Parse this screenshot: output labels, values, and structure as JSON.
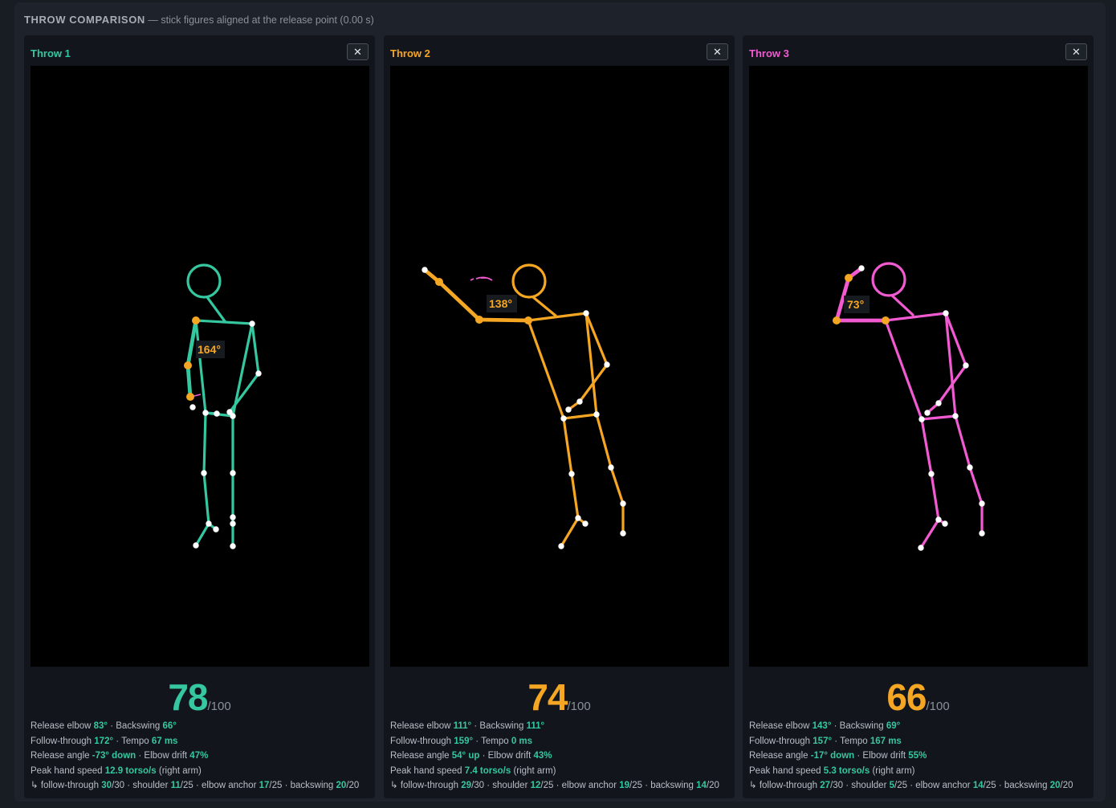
{
  "header": {
    "title": "THROW COMPARISON",
    "subtitle": "— stick figures aligned at the release point (0.00 s)"
  },
  "colors": {
    "green": "#35c79f",
    "orange": "#f5a623",
    "pink": "#f25ad2",
    "joint": "#ffffff",
    "value": "#35c79f"
  },
  "throws": [
    {
      "name": "Throw 1",
      "color": "#35c79f",
      "close": "✕",
      "angle": "164°",
      "score": "78",
      "score_color": "#35c79f",
      "score_suffix": "/100",
      "stats": {
        "release_elbow_label": "Release elbow",
        "release_elbow": "83°",
        "sep1": " · ",
        "backswing_label": "Backswing",
        "backswing": "66°",
        "follow_through_label": "Follow-through",
        "follow_through": "172°",
        "sep2": " · ",
        "tempo_label": "Tempo",
        "tempo": "67 ms",
        "release_angle_label": "Release angle",
        "release_angle": "-73° down",
        "sep3": " · ",
        "elbow_drift_label": "Elbow drift",
        "elbow_drift": "47%",
        "peak_hand_label": "Peak hand speed",
        "peak_hand": "12.9 torso/s",
        "peak_hand_suffix": "(right arm)",
        "bd_prefix": "↳ follow-through",
        "bd_ft": "30",
        "bd_ft_max": "/30 · shoulder",
        "bd_sh": "11",
        "bd_sh_max": "/25 · elbow anchor",
        "bd_ea": "17",
        "bd_ea_max": "/25 · backswing",
        "bd_bs": "20",
        "bd_bs_max": "/20"
      }
    },
    {
      "name": "Throw 2",
      "color": "#f5a623",
      "close": "✕",
      "angle": "138°",
      "score": "74",
      "score_color": "#f5a623",
      "score_suffix": "/100",
      "stats": {
        "release_elbow_label": "Release elbow",
        "release_elbow": "111°",
        "sep1": " · ",
        "backswing_label": "Backswing",
        "backswing": "111°",
        "follow_through_label": "Follow-through",
        "follow_through": "159°",
        "sep2": " · ",
        "tempo_label": "Tempo",
        "tempo": "0 ms",
        "release_angle_label": "Release angle",
        "release_angle": "54° up",
        "sep3": " · ",
        "elbow_drift_label": "Elbow drift",
        "elbow_drift": "43%",
        "peak_hand_label": "Peak hand speed",
        "peak_hand": "7.4 torso/s",
        "peak_hand_suffix": "(right arm)",
        "bd_prefix": "↳ follow-through",
        "bd_ft": "29",
        "bd_ft_max": "/30 · shoulder",
        "bd_sh": "12",
        "bd_sh_max": "/25 · elbow anchor",
        "bd_ea": "19",
        "bd_ea_max": "/25 · backswing",
        "bd_bs": "14",
        "bd_bs_max": "/20"
      }
    },
    {
      "name": "Throw 3",
      "color": "#f25ad2",
      "close": "✕",
      "angle": "73°",
      "score": "66",
      "score_color": "#f5a623",
      "score_suffix": "/100",
      "stats": {
        "release_elbow_label": "Release elbow",
        "release_elbow": "143°",
        "sep1": " · ",
        "backswing_label": "Backswing",
        "backswing": "69°",
        "follow_through_label": "Follow-through",
        "follow_through": "157°",
        "sep2": " · ",
        "tempo_label": "Tempo",
        "tempo": "167 ms",
        "release_angle_label": "Release angle",
        "release_angle": "-17° down",
        "sep3": " · ",
        "elbow_drift_label": "Elbow drift",
        "elbow_drift": "55%",
        "peak_hand_label": "Peak hand speed",
        "peak_hand": "5.3 torso/s",
        "peak_hand_suffix": "(right arm)",
        "bd_prefix": "↳ follow-through",
        "bd_ft": "27",
        "bd_ft_max": "/30 · shoulder",
        "bd_sh": "5",
        "bd_sh_max": "/25 · elbow anchor",
        "bd_ea": "14",
        "bd_ea_max": "/25 · backswing",
        "bd_bs": "20",
        "bd_bs_max": "/20"
      }
    }
  ]
}
